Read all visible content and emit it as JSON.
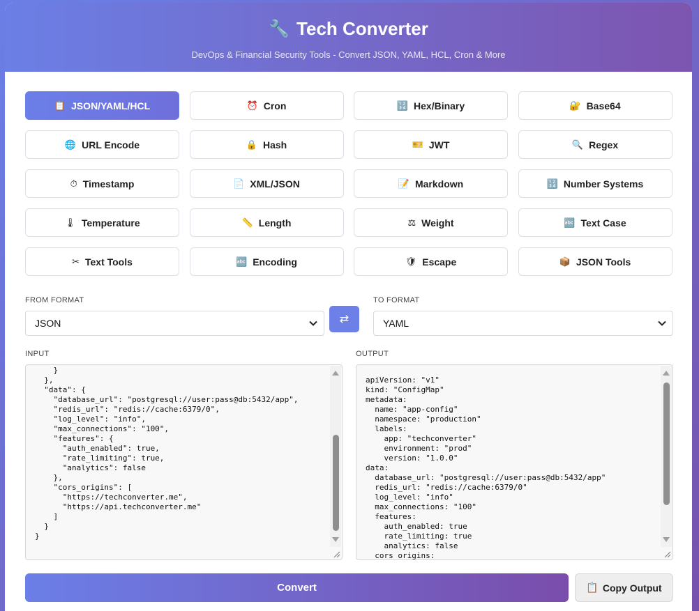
{
  "header": {
    "title": "Tech Converter",
    "icon": "wrench-icon",
    "subtitle": "DevOps & Financial Security Tools - Convert JSON, YAML, HCL, Cron & More"
  },
  "tools": [
    {
      "label": "JSON/YAML/HCL",
      "icon": "📋",
      "active": true
    },
    {
      "label": "Cron",
      "icon": "⏰"
    },
    {
      "label": "Hex/Binary",
      "icon": "🔢"
    },
    {
      "label": "Base64",
      "icon": "🔐"
    },
    {
      "label": "URL Encode",
      "icon": "🌐"
    },
    {
      "label": "Hash",
      "icon": "🔒"
    },
    {
      "label": "JWT",
      "icon": "🎫"
    },
    {
      "label": "Regex",
      "icon": "🔍"
    },
    {
      "label": "Timestamp",
      "icon": "⏱"
    },
    {
      "label": "XML/JSON",
      "icon": "📄"
    },
    {
      "label": "Markdown",
      "icon": "📝"
    },
    {
      "label": "Number Systems",
      "icon": "🔢"
    },
    {
      "label": "Temperature",
      "icon": "🌡"
    },
    {
      "label": "Length",
      "icon": "📏"
    },
    {
      "label": "Weight",
      "icon": "⚖"
    },
    {
      "label": "Text Case",
      "icon": "🔤"
    },
    {
      "label": "Text Tools",
      "icon": "✂"
    },
    {
      "label": "Encoding",
      "icon": "🔤"
    },
    {
      "label": "Escape",
      "icon": "🛡"
    },
    {
      "label": "JSON Tools",
      "icon": "📦"
    }
  ],
  "format": {
    "from_label": "FROM FORMAT",
    "from_value": "JSON",
    "to_label": "TO FORMAT",
    "to_value": "YAML",
    "swap_icon": "⇄"
  },
  "input": {
    "label": "INPUT",
    "text": "    }\n  },\n  \"data\": {\n    \"database_url\": \"postgresql://user:pass@db:5432/app\",\n    \"redis_url\": \"redis://cache:6379/0\",\n    \"log_level\": \"info\",\n    \"max_connections\": \"100\",\n    \"features\": {\n      \"auth_enabled\": true,\n      \"rate_limiting\": true,\n      \"analytics\": false\n    },\n    \"cors_origins\": [\n      \"https://techconverter.me\",\n      \"https://api.techconverter.me\"\n    ]\n  }\n}"
  },
  "output": {
    "label": "OUTPUT",
    "text": "apiVersion: \"v1\"\nkind: \"ConfigMap\"\nmetadata:\n  name: \"app-config\"\n  namespace: \"production\"\n  labels:\n    app: \"techconverter\"\n    environment: \"prod\"\n    version: \"1.0.0\"\ndata:\n  database_url: \"postgresql://user:pass@db:5432/app\"\n  redis_url: \"redis://cache:6379/0\"\n  log_level: \"info\"\n  max_connections: \"100\"\n  features:\n    auth_enabled: true\n    rate_limiting: true\n    analytics: false\n  cors_origins:"
  },
  "actions": {
    "convert_label": "Convert",
    "copy_label": "Copy Output",
    "copy_icon": "📋"
  }
}
